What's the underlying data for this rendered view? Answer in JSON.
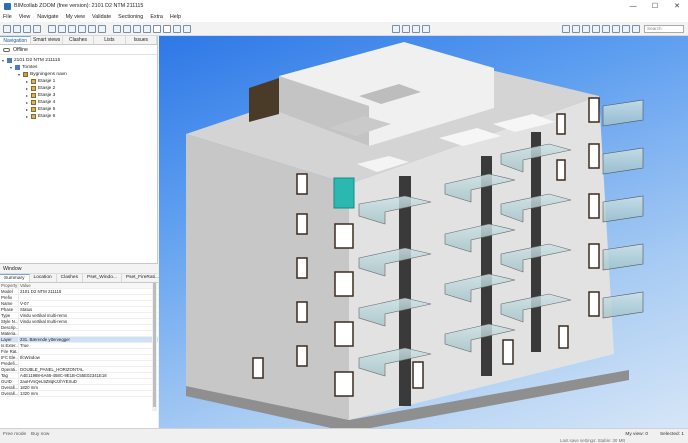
{
  "window": {
    "title": "BIMcollab ZOOM (free version): 2101 D2 NTM 211115",
    "minimize": "—",
    "maximize": "☐",
    "close": "✕"
  },
  "menu": [
    "File",
    "View",
    "Navigate",
    "My view",
    "Validate",
    "Sectioning",
    "Extra",
    "Help"
  ],
  "search": {
    "placeholder": "Search"
  },
  "left_panel": {
    "tabs": [
      "Navigation",
      "Smart views",
      "Clashes",
      "Lists",
      "Issues"
    ],
    "status": "Offline",
    "tree": [
      {
        "label": "2101 D2 NTM 211115",
        "indent": 0,
        "icon": "file"
      },
      {
        "label": "Tomtes",
        "indent": 1,
        "icon": "site"
      },
      {
        "label": "Bygningens navn",
        "indent": 2,
        "icon": "building"
      },
      {
        "label": "Etasje 1",
        "indent": 3,
        "icon": "floor"
      },
      {
        "label": "Etasje 2",
        "indent": 3,
        "icon": "floor"
      },
      {
        "label": "Etasje 3",
        "indent": 3,
        "icon": "floor"
      },
      {
        "label": "Etasje 4",
        "indent": 3,
        "icon": "floor"
      },
      {
        "label": "Etasje 5",
        "indent": 3,
        "icon": "floor"
      },
      {
        "label": "Etasje 6",
        "indent": 3,
        "icon": "floor"
      }
    ]
  },
  "properties_panel": {
    "title": "Window",
    "tabs": [
      "Summary",
      "Location",
      "Clashes",
      "Pset_Windo...",
      "Pset_FireRati..."
    ],
    "header": {
      "key": "Property",
      "value": "Value"
    },
    "rows": [
      {
        "key": "Model",
        "value": "2101 D2 NTM 211115"
      },
      {
        "key": "Prefix",
        "value": ""
      },
      {
        "key": "Name",
        "value": "V-07"
      },
      {
        "key": "Phase",
        "value": "Status"
      },
      {
        "key": "Type",
        "value": "Vindu vertikal multi-rems"
      },
      {
        "key": "Style N...",
        "value": "Vindu vertikal multi-rems"
      },
      {
        "key": "Descrip...",
        "value": ""
      },
      {
        "key": "Materia...",
        "value": ""
      },
      {
        "key": "Layer",
        "value": "231. Bærende yttervegger"
      },
      {
        "key": "Is Exter...",
        "value": "True"
      },
      {
        "key": "Fire Rat...",
        "value": ""
      },
      {
        "key": "IFC Ele...",
        "value": "IfcWindow"
      },
      {
        "key": "Predefi...",
        "value": ""
      },
      {
        "key": "Operati...",
        "value": "DOUBLE_PANEL_HORIZONTAL"
      },
      {
        "key": "Tag",
        "value": "A4E11988-6A65-458C-9E1B-C55E02341E18"
      },
      {
        "key": "GUID",
        "value": "2auHVsQeL9Z8qKzzhYEXuD"
      },
      {
        "key": "Overall...",
        "value": "1820 mm"
      },
      {
        "key": "Overall...",
        "value": "1320 mm"
      }
    ]
  },
  "statusbar": {
    "mode": "Free mode",
    "buy": "Buy now",
    "view": "My view: 0",
    "selected": "Selected: 1",
    "memory": "Last save settings: Stable: 30 MB"
  }
}
